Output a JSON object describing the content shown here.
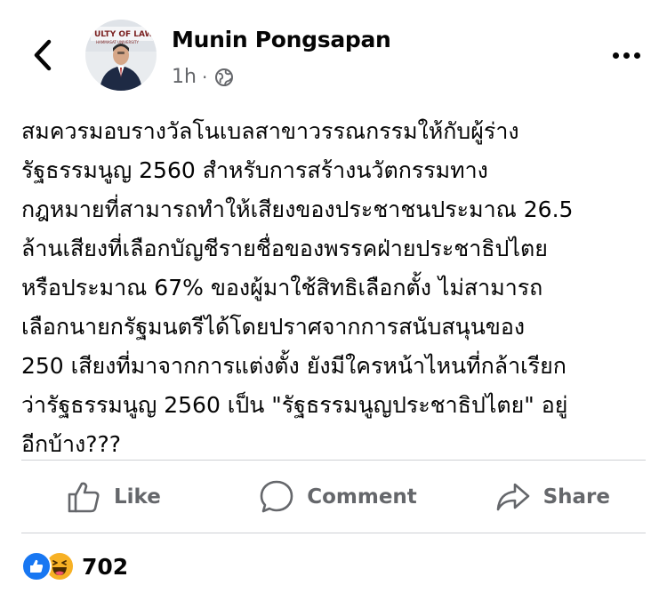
{
  "header": {
    "back_icon": "chevron-left-icon",
    "more_icon": "ellipsis-horizontal-icon"
  },
  "author": {
    "name": "Munin Pongsapan",
    "avatar_text": "ULTY OF LAW",
    "avatar_subtext": "HAMMASAT UNIVERSITY"
  },
  "meta": {
    "time": "1h",
    "separator": "·",
    "privacy_icon": "globe-icon"
  },
  "post": {
    "text": "สมควรมอบรางวัลโนเบลสาขาวรรณกรรมให้กับผู้ร่าง\nรัฐธรรมนูญ 2560 สำหรับการสร้างนวัตกรรมทาง\nกฎหมายที่สามารถทำให้เสียงของประชาชนประมาณ 26.5\nล้านเสียงที่เลือกบัญชีรายชื่อของพรรคฝ่ายประชาธิปไตย\nหรือประมาณ 67% ของผู้มาใช้สิทธิเลือกตั้ง ไม่สามารถ\nเลือกนายกรัฐมนตรีได้โดยปราศจากการสนับสนุนของ\n250 เสียงที่มาจากการแต่งตั้ง ยังมีใครหน้าไหนที่กล้าเรียก\nว่ารัฐธรรมนูญ 2560 เป็น \"รัฐธรรมนูญประชาธิปไตย\" อยู่\nอีกบ้าง???"
  },
  "actions": {
    "like": "Like",
    "comment": "Comment",
    "share": "Share"
  },
  "reactions": {
    "types": [
      "like",
      "haha"
    ],
    "count": "702"
  },
  "colors": {
    "text": "#050505",
    "secondary": "#65676b",
    "divider": "#ced0d4",
    "like_blue": "#1877f2",
    "haha_yellow": "#f7b125"
  }
}
